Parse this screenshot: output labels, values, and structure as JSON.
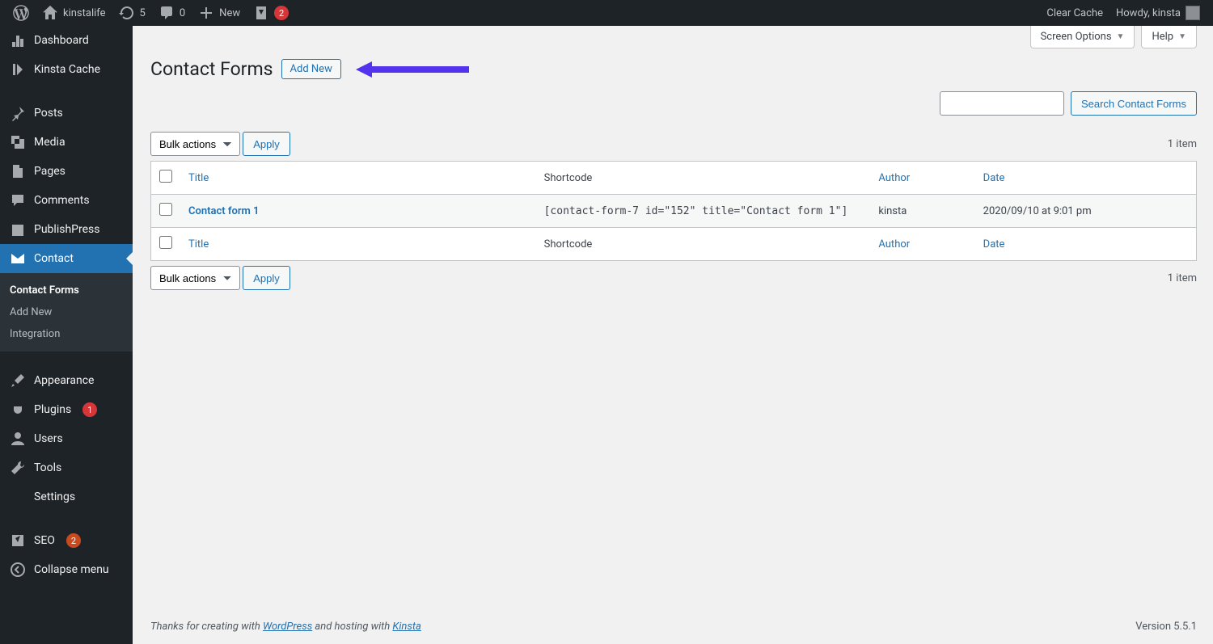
{
  "adminbar": {
    "site_name": "kinstalife",
    "updates_count": "5",
    "comments_count": "0",
    "new_label": "New",
    "notif_count": "2",
    "clear_cache": "Clear Cache",
    "howdy": "Howdy, kinsta"
  },
  "sidebar": {
    "dashboard": "Dashboard",
    "kinsta_cache": "Kinsta Cache",
    "posts": "Posts",
    "media": "Media",
    "pages": "Pages",
    "comments": "Comments",
    "publishpress": "PublishPress",
    "contact": "Contact",
    "appearance": "Appearance",
    "plugins": "Plugins",
    "plugins_badge": "1",
    "users": "Users",
    "tools": "Tools",
    "settings": "Settings",
    "seo": "SEO",
    "seo_badge": "2",
    "collapse": "Collapse menu",
    "submenu": {
      "contact_forms": "Contact Forms",
      "add_new": "Add New",
      "integration": "Integration"
    }
  },
  "screen_meta": {
    "screen_options": "Screen Options",
    "help": "Help"
  },
  "page": {
    "title": "Contact Forms",
    "add_new": "Add New",
    "search_button": "Search Contact Forms",
    "bulk_actions": "Bulk actions",
    "apply": "Apply",
    "item_count": "1 item"
  },
  "table": {
    "columns": {
      "title": "Title",
      "shortcode": "Shortcode",
      "author": "Author",
      "date": "Date"
    },
    "rows": [
      {
        "title": "Contact form 1",
        "shortcode": "[contact-form-7 id=\"152\" title=\"Contact form 1\"]",
        "author": "kinsta",
        "date": "2020/09/10 at 9:01 pm"
      }
    ]
  },
  "footer": {
    "prefix": "Thanks for creating with ",
    "wordpress": "WordPress",
    "mid": " and hosting with ",
    "kinsta": "Kinsta",
    "version": "Version 5.5.1"
  }
}
